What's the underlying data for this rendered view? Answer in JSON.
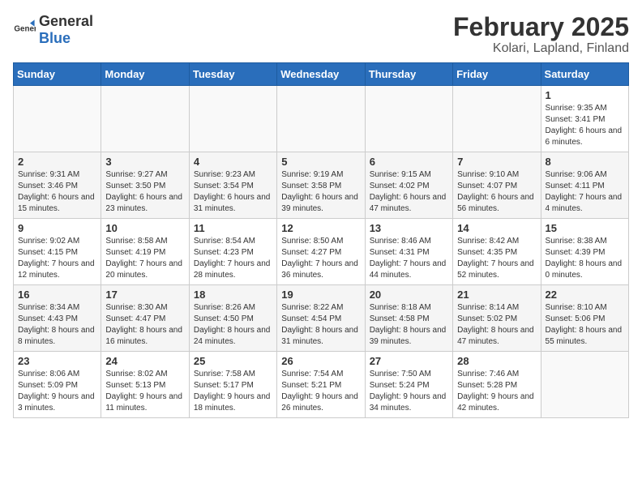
{
  "header": {
    "logo_general": "General",
    "logo_blue": "Blue",
    "month": "February 2025",
    "location": "Kolari, Lapland, Finland"
  },
  "days_of_week": [
    "Sunday",
    "Monday",
    "Tuesday",
    "Wednesday",
    "Thursday",
    "Friday",
    "Saturday"
  ],
  "weeks": [
    [
      {
        "day": "",
        "info": ""
      },
      {
        "day": "",
        "info": ""
      },
      {
        "day": "",
        "info": ""
      },
      {
        "day": "",
        "info": ""
      },
      {
        "day": "",
        "info": ""
      },
      {
        "day": "",
        "info": ""
      },
      {
        "day": "1",
        "info": "Sunrise: 9:35 AM\nSunset: 3:41 PM\nDaylight: 6 hours and 6 minutes."
      }
    ],
    [
      {
        "day": "2",
        "info": "Sunrise: 9:31 AM\nSunset: 3:46 PM\nDaylight: 6 hours and 15 minutes."
      },
      {
        "day": "3",
        "info": "Sunrise: 9:27 AM\nSunset: 3:50 PM\nDaylight: 6 hours and 23 minutes."
      },
      {
        "day": "4",
        "info": "Sunrise: 9:23 AM\nSunset: 3:54 PM\nDaylight: 6 hours and 31 minutes."
      },
      {
        "day": "5",
        "info": "Sunrise: 9:19 AM\nSunset: 3:58 PM\nDaylight: 6 hours and 39 minutes."
      },
      {
        "day": "6",
        "info": "Sunrise: 9:15 AM\nSunset: 4:02 PM\nDaylight: 6 hours and 47 minutes."
      },
      {
        "day": "7",
        "info": "Sunrise: 9:10 AM\nSunset: 4:07 PM\nDaylight: 6 hours and 56 minutes."
      },
      {
        "day": "8",
        "info": "Sunrise: 9:06 AM\nSunset: 4:11 PM\nDaylight: 7 hours and 4 minutes."
      }
    ],
    [
      {
        "day": "9",
        "info": "Sunrise: 9:02 AM\nSunset: 4:15 PM\nDaylight: 7 hours and 12 minutes."
      },
      {
        "day": "10",
        "info": "Sunrise: 8:58 AM\nSunset: 4:19 PM\nDaylight: 7 hours and 20 minutes."
      },
      {
        "day": "11",
        "info": "Sunrise: 8:54 AM\nSunset: 4:23 PM\nDaylight: 7 hours and 28 minutes."
      },
      {
        "day": "12",
        "info": "Sunrise: 8:50 AM\nSunset: 4:27 PM\nDaylight: 7 hours and 36 minutes."
      },
      {
        "day": "13",
        "info": "Sunrise: 8:46 AM\nSunset: 4:31 PM\nDaylight: 7 hours and 44 minutes."
      },
      {
        "day": "14",
        "info": "Sunrise: 8:42 AM\nSunset: 4:35 PM\nDaylight: 7 hours and 52 minutes."
      },
      {
        "day": "15",
        "info": "Sunrise: 8:38 AM\nSunset: 4:39 PM\nDaylight: 8 hours and 0 minutes."
      }
    ],
    [
      {
        "day": "16",
        "info": "Sunrise: 8:34 AM\nSunset: 4:43 PM\nDaylight: 8 hours and 8 minutes."
      },
      {
        "day": "17",
        "info": "Sunrise: 8:30 AM\nSunset: 4:47 PM\nDaylight: 8 hours and 16 minutes."
      },
      {
        "day": "18",
        "info": "Sunrise: 8:26 AM\nSunset: 4:50 PM\nDaylight: 8 hours and 24 minutes."
      },
      {
        "day": "19",
        "info": "Sunrise: 8:22 AM\nSunset: 4:54 PM\nDaylight: 8 hours and 31 minutes."
      },
      {
        "day": "20",
        "info": "Sunrise: 8:18 AM\nSunset: 4:58 PM\nDaylight: 8 hours and 39 minutes."
      },
      {
        "day": "21",
        "info": "Sunrise: 8:14 AM\nSunset: 5:02 PM\nDaylight: 8 hours and 47 minutes."
      },
      {
        "day": "22",
        "info": "Sunrise: 8:10 AM\nSunset: 5:06 PM\nDaylight: 8 hours and 55 minutes."
      }
    ],
    [
      {
        "day": "23",
        "info": "Sunrise: 8:06 AM\nSunset: 5:09 PM\nDaylight: 9 hours and 3 minutes."
      },
      {
        "day": "24",
        "info": "Sunrise: 8:02 AM\nSunset: 5:13 PM\nDaylight: 9 hours and 11 minutes."
      },
      {
        "day": "25",
        "info": "Sunrise: 7:58 AM\nSunset: 5:17 PM\nDaylight: 9 hours and 18 minutes."
      },
      {
        "day": "26",
        "info": "Sunrise: 7:54 AM\nSunset: 5:21 PM\nDaylight: 9 hours and 26 minutes."
      },
      {
        "day": "27",
        "info": "Sunrise: 7:50 AM\nSunset: 5:24 PM\nDaylight: 9 hours and 34 minutes."
      },
      {
        "day": "28",
        "info": "Sunrise: 7:46 AM\nSunset: 5:28 PM\nDaylight: 9 hours and 42 minutes."
      },
      {
        "day": "",
        "info": ""
      }
    ]
  ]
}
